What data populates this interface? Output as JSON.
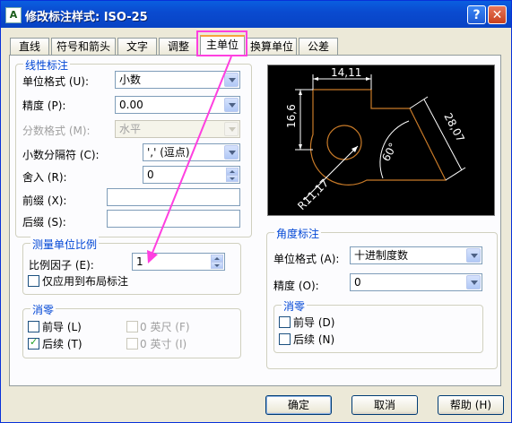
{
  "dialog": {
    "title": "修改标注样式: ISO-25",
    "help_glyph": "?",
    "close_glyph": "✕",
    "icon_glyph": "A"
  },
  "tabs": [
    "直线",
    "符号和箭头",
    "文字",
    "调整",
    "主单位",
    "换算单位",
    "公差"
  ],
  "active_tab": "主单位",
  "linear": {
    "title": "线性标注",
    "unit_format_label": "单位格式 (U):",
    "unit_format_value": "小数",
    "precision_label": "精度 (P):",
    "precision_value": "0.00",
    "fraction_label": "分数格式 (M):",
    "fraction_value": "水平",
    "decimal_sep_label": "小数分隔符 (C):",
    "decimal_sep_value": "',' (逗点)",
    "round_label": "舍入 (R):",
    "round_value": "0",
    "prefix_label": "前缀 (X):",
    "prefix_value": "",
    "suffix_label": "后缀 (S):",
    "suffix_value": ""
  },
  "scale": {
    "title": "测量单位比例",
    "factor_label": "比例因子 (E):",
    "factor_value": "1",
    "layout_only_label": "仅应用到布局标注"
  },
  "zero_linear": {
    "title": "消零",
    "leading_label": "前导 (L)",
    "trailing_label": "后续 (T)",
    "feet_label": "0 英尺 (F)",
    "inches_label": "0 英寸 (I)",
    "leading_checked": false,
    "trailing_checked": true
  },
  "angular": {
    "title": "角度标注",
    "unit_format_label": "单位格式 (A):",
    "unit_format_value": "十进制度数",
    "precision_label": "精度 (O):",
    "precision_value": "0"
  },
  "zero_angular": {
    "title": "消零",
    "leading_label": "前导 (D)",
    "trailing_label": "后续 (N)"
  },
  "preview": {
    "dim_top": "14,11",
    "dim_left": "16,6",
    "dim_right": "28,07",
    "dim_angle": "60°",
    "dim_radius": "R11,17"
  },
  "buttons": {
    "ok": "确定",
    "cancel": "取消",
    "help": "帮助 (H)"
  },
  "colors": {
    "title_bar": "#0a4bd0",
    "group_title": "#0046d5",
    "annotation": "#ff3fe0",
    "preview_geometry": "#c87a28"
  }
}
